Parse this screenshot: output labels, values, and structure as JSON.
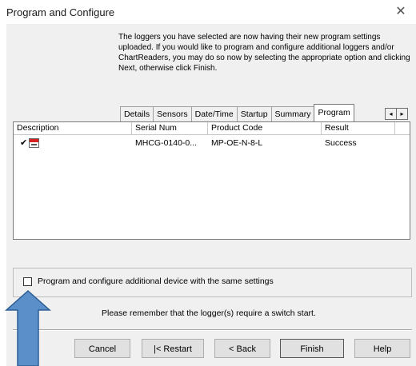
{
  "window": {
    "title": "Program and Configure",
    "close_glyph": "✕"
  },
  "intro_text": "The loggers you have selected are now having their new program settings uploaded. If you would like to program and configure additional loggers and/or ChartReaders, you may do so now by selecting the appropriate option and clicking Next, otherwise click Finish.",
  "tabs": [
    {
      "label": "Details",
      "active": false
    },
    {
      "label": "Sensors",
      "active": false
    },
    {
      "label": "Date/Time",
      "active": false
    },
    {
      "label": "Startup",
      "active": false
    },
    {
      "label": "Summary",
      "active": false
    },
    {
      "label": "Program",
      "active": true
    }
  ],
  "tab_scroll": {
    "left": "◂",
    "right": "▸"
  },
  "table": {
    "columns": [
      "Description",
      "Serial Num",
      "Product Code",
      "Result"
    ],
    "rows": [
      {
        "checked_glyph": "✔",
        "icon": "logger-device-icon",
        "serial": "MHCG-0140-0...",
        "product_code": "MP-OE-N-8-L",
        "result": "Success"
      }
    ]
  },
  "option": {
    "label": "Program and configure additional device with the same settings",
    "checked": false
  },
  "reminder": "Please remember that the logger(s) require a switch start.",
  "buttons": {
    "cancel": "Cancel",
    "restart": "|< Restart",
    "back": "< Back",
    "finish": "Finish",
    "help": "Help"
  },
  "colors": {
    "annotation_arrow": "#5b8fc9",
    "arrow_outline": "#2d5f96",
    "device_red": "#d92020"
  }
}
